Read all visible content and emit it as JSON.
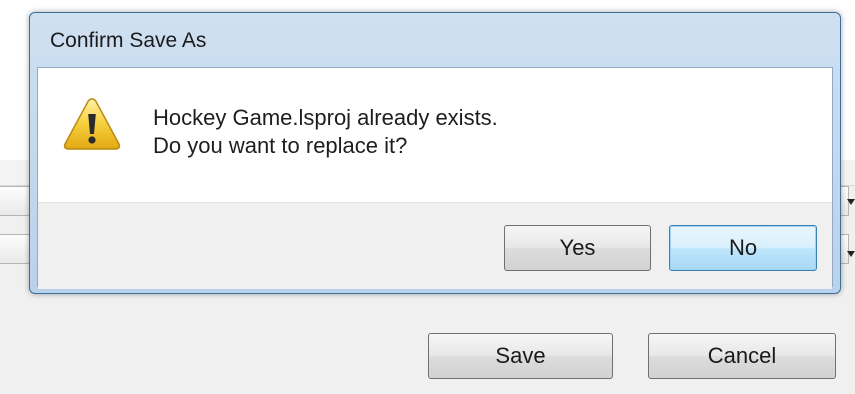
{
  "dialog": {
    "title": "Confirm Save As",
    "message_line1": "Hockey Game.lsproj already exists.",
    "message_line2": "Do you want to replace it?",
    "icon": "warning-icon",
    "buttons": {
      "yes": "Yes",
      "no": "No"
    },
    "default_button": "No"
  },
  "background_window": {
    "save_label": "Save",
    "cancel_label": "Cancel"
  },
  "colors": {
    "titlebar": "#b9d1ea",
    "dialog_border": "#3b6f99",
    "default_button_border": "#3c7fb1",
    "warning_yellow": "#f4c531"
  }
}
